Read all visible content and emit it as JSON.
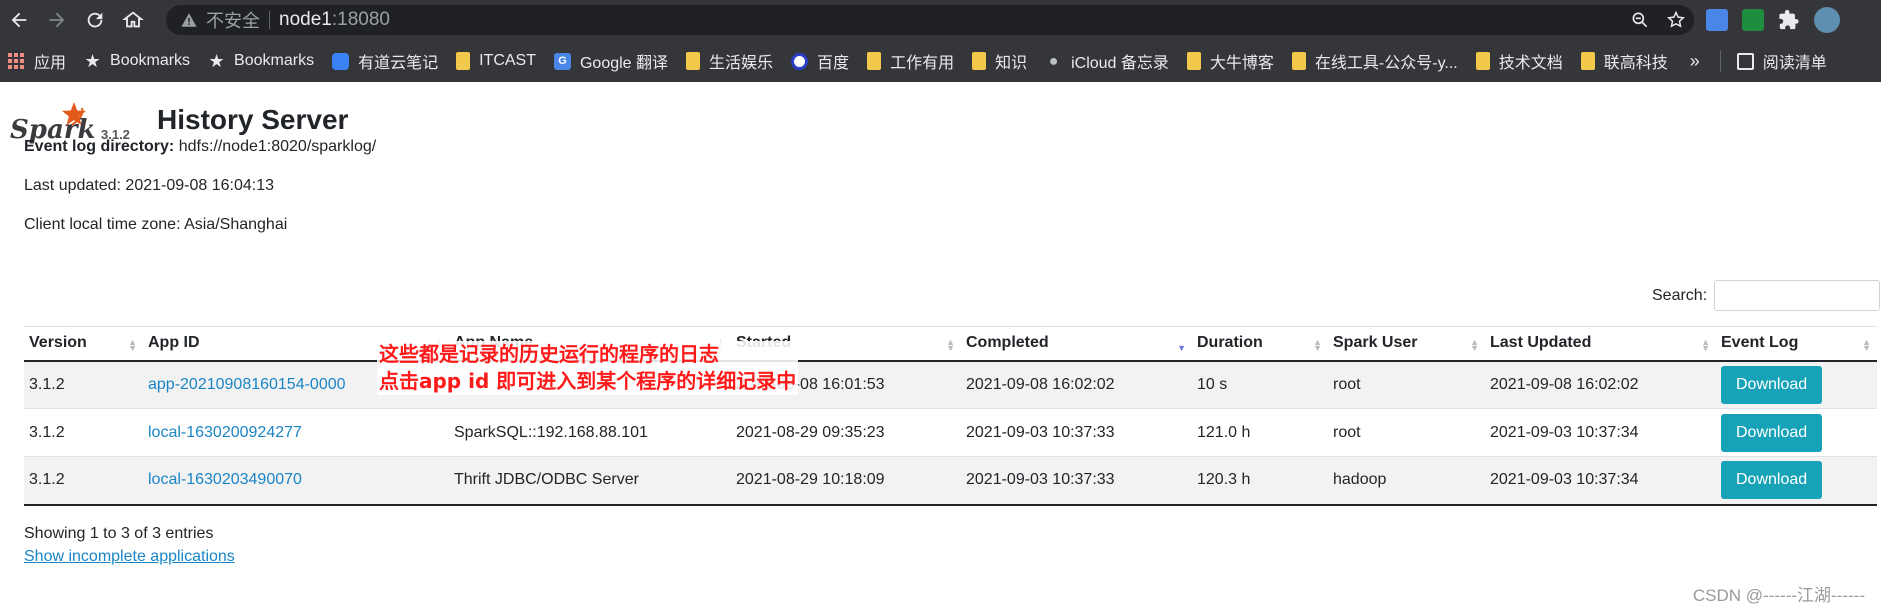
{
  "browser": {
    "insecure_label": "不安全",
    "host": "node1",
    "port": ":18080",
    "bookmarks": [
      {
        "label": "应用",
        "icon": "apps-grid-icon"
      },
      {
        "label": "Bookmarks",
        "icon": "star-icon"
      },
      {
        "label": "Bookmarks",
        "icon": "star-icon"
      },
      {
        "label": "有道云笔记",
        "icon": "youdao-note-icon"
      },
      {
        "label": "ITCAST",
        "icon": "folder-icon"
      },
      {
        "label": "Google 翻译",
        "icon": "google-translate-icon"
      },
      {
        "label": "生活娱乐",
        "icon": "folder-icon"
      },
      {
        "label": "百度",
        "icon": "baidu-icon"
      },
      {
        "label": "工作有用",
        "icon": "folder-icon"
      },
      {
        "label": "知识",
        "icon": "folder-icon"
      },
      {
        "label": "iCloud 备忘录",
        "icon": "apple-icon"
      },
      {
        "label": "大牛博客",
        "icon": "folder-icon"
      },
      {
        "label": "在线工具-公众号-y...",
        "icon": "folder-icon"
      },
      {
        "label": "技术文档",
        "icon": "folder-icon"
      },
      {
        "label": "联高科技",
        "icon": "folder-icon"
      }
    ],
    "more": "»",
    "reading_list": "阅读清单"
  },
  "page": {
    "spark_version": "3.1.2",
    "title": "History Server",
    "event_log_label": "Event log directory:",
    "event_log_value": "hdfs://node1:8020/sparklog/",
    "last_updated": "Last updated: 2021-09-08 16:04:13",
    "time_zone": "Client local time zone: Asia/Shanghai",
    "search_label": "Search:",
    "columns": [
      "Version",
      "App ID",
      "App Name",
      "Started",
      "Completed",
      "Duration",
      "Spark User",
      "Last Updated",
      "Event Log"
    ],
    "rows": [
      {
        "version": "3.1.2",
        "app_id": "app-20210908160154-0000",
        "app_name": "",
        "started": "2021-09-08 16:01:53",
        "completed": "2021-09-08 16:02:02",
        "duration": "10 s",
        "user": "root",
        "last_updated": "2021-09-08 16:02:02",
        "action": "Download"
      },
      {
        "version": "3.1.2",
        "app_id": "local-1630200924277",
        "app_name": "SparkSQL::192.168.88.101",
        "started": "2021-08-29 09:35:23",
        "completed": "2021-09-03 10:37:33",
        "duration": "121.0 h",
        "user": "root",
        "last_updated": "2021-09-03 10:37:34",
        "action": "Download"
      },
      {
        "version": "3.1.2",
        "app_id": "local-1630203490070",
        "app_name": "Thrift JDBC/ODBC Server",
        "started": "2021-08-29 10:18:09",
        "completed": "2021-09-03 10:37:33",
        "duration": "120.3 h",
        "user": "hadoop",
        "last_updated": "2021-09-03 10:37:34",
        "action": "Download"
      }
    ],
    "showing": "Showing 1 to 3 of 3 entries",
    "incomplete_link": "Show incomplete applications"
  },
  "annotation": {
    "line1": "这些都是记录的历史运行的程序的日志",
    "line2": "点击app id 即可进入到某个程序的详细记录中"
  },
  "watermark": "CSDN @------江湖------",
  "colors": {
    "chrome": "#35363a",
    "link": "#1a85c6",
    "button": "#17a2b8",
    "annotation": "#ff1a1a"
  }
}
